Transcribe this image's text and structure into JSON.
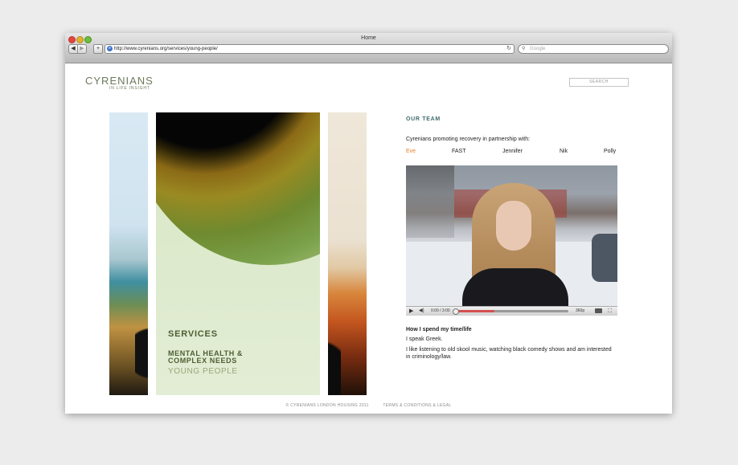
{
  "browser": {
    "window_title": "Home",
    "url": "http://www.cyrenians.org/services/young-people/",
    "search_placeholder": "Google"
  },
  "site": {
    "logo_main": "CYRENIANS",
    "logo_sub": "IN LIFE INSIGHT",
    "search_label": "SEARCH"
  },
  "services": {
    "title": "SERVICES",
    "items": [
      "MENTAL HEALTH & COMPLEX NEEDS",
      "YOUNG PEOPLE"
    ]
  },
  "team": {
    "heading": "OUR TEAM",
    "intro": "Cyrenians promoting recovery in partnership with:",
    "members": [
      "Eve",
      "FAST",
      "Jennifer",
      "Nik",
      "Polly"
    ],
    "active_member": "Eve"
  },
  "video": {
    "time": "0:00 / 3:00",
    "quality": "360p",
    "progress": 0.35
  },
  "bio": {
    "heading": "How I spend my time/life",
    "line1": "I speak Greek.",
    "line2": "I like listening to old skool music, watching black comedy shows and am interested in criminology/law."
  },
  "footer": {
    "copyright": "© CYRENIANS LONDON HOUSING 2011",
    "terms": "TERMS & CONDITIONS & LEGAL"
  }
}
